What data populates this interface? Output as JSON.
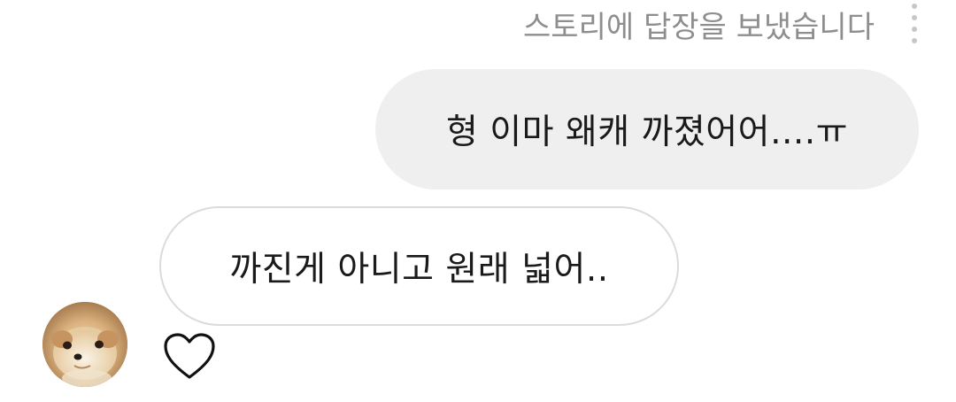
{
  "conversation": {
    "story_reply_note": "스토리에 답장을 보냈습니다",
    "messages": [
      {
        "direction": "sent",
        "text": "형 이마 왜캐 까졌어어....ㅠ"
      },
      {
        "direction": "received",
        "text": "까진게 아니고 원래 넓어.."
      }
    ]
  },
  "icons": {
    "more": "vertical-dots-icon",
    "like": "heart-icon",
    "avatar": "pomeranian-dog-avatar"
  },
  "colors": {
    "note_text": "#8e8e8e",
    "sent_bubble_bg": "#efefef",
    "received_bubble_border": "#dbdbdb",
    "message_text": "#1a1a1a"
  }
}
